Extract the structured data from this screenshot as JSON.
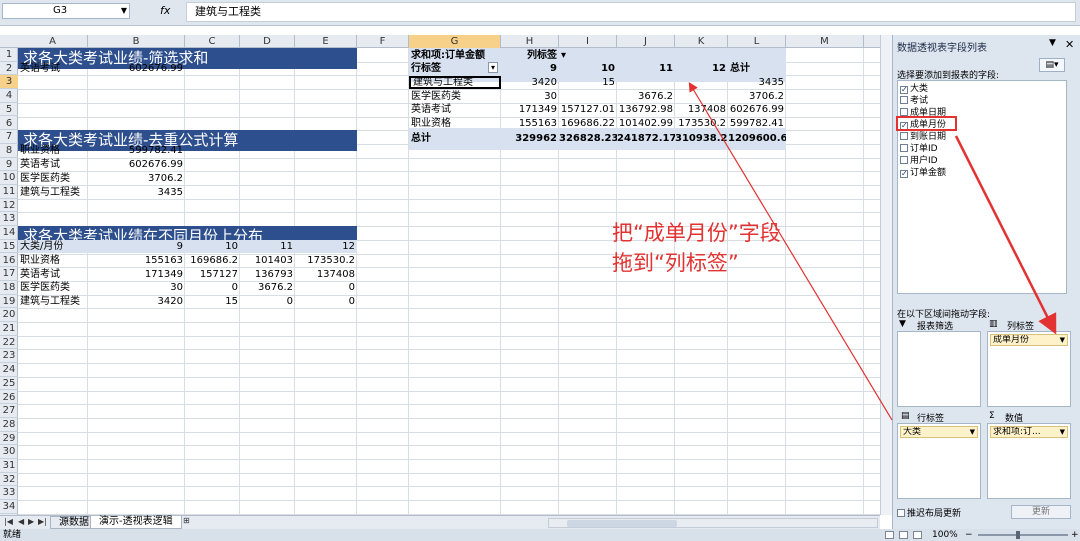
{
  "formula_bar": {
    "name_box": "G3",
    "fx": "fx",
    "content": "建筑与工程类"
  },
  "columns": [
    "A",
    "B",
    "C",
    "D",
    "E",
    "F",
    "G",
    "H",
    "I",
    "J",
    "K",
    "L",
    "M"
  ],
  "rows": [
    "1",
    "2",
    "3",
    "4",
    "5",
    "6",
    "7",
    "8",
    "9",
    "10",
    "11",
    "12",
    "13",
    "14",
    "15",
    "16",
    "17",
    "18",
    "19",
    "20",
    "21",
    "22",
    "23",
    "24",
    "25",
    "26",
    "27",
    "28",
    "29",
    "30",
    "31",
    "32",
    "33",
    "34"
  ],
  "section1": {
    "title": "求各大类考试业绩-筛选求和",
    "label": "英语考试",
    "value": "602676.99"
  },
  "section2": {
    "title": "求各大类考试业绩-去重公式计算",
    "rows": [
      {
        "label": "职业资格",
        "value": "599782.41"
      },
      {
        "label": "英语考试",
        "value": "602676.99"
      },
      {
        "label": "医学医药类",
        "value": "3706.2"
      },
      {
        "label": "建筑与工程类",
        "value": "3435"
      }
    ]
  },
  "section3": {
    "title": "求各大类考试业绩在不同月份上分布",
    "header": [
      "大类/月份",
      "9",
      "10",
      "11",
      "12"
    ],
    "rows": [
      [
        "职业资格",
        "155163",
        "169686.2",
        "101403",
        "173530.2"
      ],
      [
        "英语考试",
        "171349",
        "157127",
        "136793",
        "137408"
      ],
      [
        "医学医药类",
        "30",
        "0",
        "3676.2",
        "0"
      ],
      [
        "建筑与工程类",
        "3420",
        "15",
        "0",
        "0"
      ]
    ]
  },
  "pivot": {
    "value_label": "求和项:订单金额",
    "col_label": "列标签",
    "row_label": "行标签",
    "col_headers": [
      "9",
      "10",
      "11",
      "12",
      "总计"
    ],
    "rows": [
      [
        "建筑与工程类",
        "3420",
        "15",
        "",
        "",
        "3435"
      ],
      [
        "医学医药类",
        "30",
        "",
        "3676.2",
        "",
        "3706.2"
      ],
      [
        "英语考试",
        "171349",
        "157127.01",
        "136792.98",
        "137408",
        "602676.99"
      ],
      [
        "职业资格",
        "155163",
        "169686.22",
        "101402.99",
        "173530.2",
        "599782.41"
      ]
    ],
    "total": [
      "总计",
      "329962",
      "326828.23",
      "241872.17",
      "310938.2",
      "1209600.6"
    ]
  },
  "annotation": {
    "line1": "把“成单月份”字段",
    "line2": "拖到“列标签”",
    "color": "#e23232"
  },
  "sheet_tabs": {
    "tabs": [
      "源数据",
      "演示-透视表逻辑"
    ],
    "active": "演示-透视表逻辑"
  },
  "status": {
    "ready": "就绪",
    "zoom": "100%",
    "minus": "−",
    "plus": "+"
  },
  "pane": {
    "title": "数据透视表字段列表",
    "choose": "选择要添加到报表的字段:",
    "fields": [
      {
        "name": "大类",
        "checked": true
      },
      {
        "name": "考试",
        "checked": false
      },
      {
        "name": "成单日期",
        "checked": false
      },
      {
        "name": "成单月份",
        "checked": true
      },
      {
        "name": "到账日期",
        "checked": false
      },
      {
        "name": "订单ID",
        "checked": false
      },
      {
        "name": "用户ID",
        "checked": false
      },
      {
        "name": "订单金额",
        "checked": true
      }
    ],
    "drag_label": "在以下区域间拖动字段:",
    "zones": {
      "filter": "报表筛选",
      "columns": "列标签",
      "rows": "行标签",
      "values": "数值"
    },
    "zone_items": {
      "columns": "成单月份",
      "rows": "大类",
      "values": "求和项:订..."
    },
    "defer": "推迟布局更新",
    "update": "更新"
  }
}
